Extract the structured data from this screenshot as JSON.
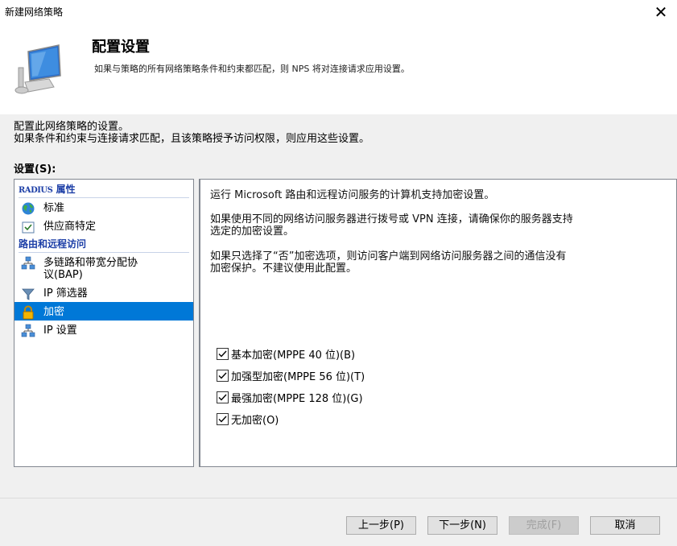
{
  "window": {
    "title": "新建网络策略"
  },
  "header": {
    "title": "配置设置",
    "description": "如果与策略的所有网络策略条件和约束都匹配，则 NPS 将对连接请求应用设置。"
  },
  "intro": {
    "line1": "配置此网络策略的设置。",
    "line2": "如果条件和约束与连接请求匹配，且该策略授予访问权限，则应用这些设置。"
  },
  "settings_label": "设置(S):",
  "sidebar": {
    "sections": [
      {
        "header_a": "RADIUS",
        "header_b": "属性",
        "items": [
          {
            "label": "标准",
            "icon": "globe-icon"
          },
          {
            "label": "供应商特定",
            "icon": "checklist-icon"
          }
        ]
      },
      {
        "header": "路由和远程访问",
        "items": [
          {
            "label_line1": "多链路和带宽分配协",
            "label_line2": "议(BAP)",
            "icon": "network-icon"
          },
          {
            "label": "IP 筛选器",
            "icon": "filter-icon"
          },
          {
            "label": "加密",
            "icon": "lock-icon",
            "selected": true
          },
          {
            "label": "IP 设置",
            "icon": "network-icon"
          }
        ]
      }
    ]
  },
  "content": {
    "para1": "运行 Microsoft 路由和远程访问服务的计算机支持加密设置。",
    "para2_line1": "如果使用不同的网络访问服务器进行拨号或 VPN 连接，请确保你的服务器支持",
    "para2_line2": "选定的加密设置。",
    "para3_line1": "如果只选择了“否”加密选项，则访问客户端到网络访问服务器之间的通信没有",
    "para3_line2": "加密保护。不建议使用此配置。",
    "checkboxes": [
      {
        "label": "基本加密(MPPE 40 位)(B)",
        "checked": true
      },
      {
        "label": "加强型加密(MPPE 56 位)(T)",
        "checked": true
      },
      {
        "label": "最强加密(MPPE 128 位)(G)",
        "checked": true
      },
      {
        "label": "无加密(O)",
        "checked": true
      }
    ]
  },
  "buttons": {
    "back": "上一步(P)",
    "next": "下一步(N)",
    "finish": "完成(F)",
    "cancel": "取消"
  },
  "colors": {
    "selection": "#0078d7",
    "section_header": "#1d3fa7"
  }
}
